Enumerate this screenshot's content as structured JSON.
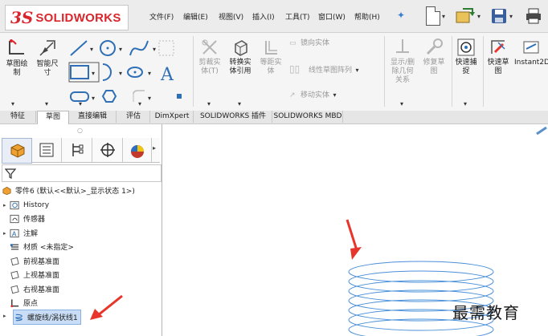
{
  "app": {
    "brand": "SOLIDWORKS",
    "logo_mark": "3S"
  },
  "menu": [
    {
      "label": "文件(F)"
    },
    {
      "label": "编辑(E)"
    },
    {
      "label": "视图(V)"
    },
    {
      "label": "插入(I)"
    },
    {
      "label": "工具(T)"
    },
    {
      "label": "窗口(W)"
    },
    {
      "label": "帮助(H)"
    }
  ],
  "ribbon": {
    "sketch": "草图绘\n制",
    "smart_dim": "智能尺\n寸",
    "cut_entities": "剪裁实\n体(T)",
    "convert_entities": "转换实\n体引用",
    "offset_entities": "等距实\n体",
    "mirror_entities": "镜向实体",
    "linear_pattern": "线性草图阵列",
    "move_entities": "移动实体",
    "display_relations": "显示/删\n除几何\n关系",
    "repair_sketch": "修复草\n图",
    "quick_snaps": "快速捕\n捉",
    "rapid_sketch": "快速草\n图",
    "instant2d": "Instant2D"
  },
  "tabs": [
    {
      "label": "特征"
    },
    {
      "label": "草图",
      "active": true
    },
    {
      "label": "直接编辑"
    },
    {
      "label": "评估"
    },
    {
      "label": "DimXpert"
    },
    {
      "label": "SOLIDWORKS 插件"
    },
    {
      "label": "SOLIDWORKS MBD"
    }
  ],
  "tree": {
    "root": "零件6 (默认<<默认>_显示状态 1>)",
    "items": [
      {
        "label": "History",
        "expandable": true
      },
      {
        "label": "传感器",
        "expandable": false
      },
      {
        "label": "注解",
        "expandable": true
      },
      {
        "label": "材质 <未指定>",
        "expandable": false
      },
      {
        "label": "前视基准面",
        "expandable": false
      },
      {
        "label": "上视基准面",
        "expandable": false
      },
      {
        "label": "右视基准面",
        "expandable": false
      },
      {
        "label": "原点",
        "expandable": false
      },
      {
        "label": "螺旋线/涡状线1",
        "expandable": true,
        "selected": true
      }
    ]
  },
  "watermark": "最需教育",
  "colors": {
    "brand_red": "#d9262c",
    "helix_blue": "#4a90d9",
    "arrow_red": "#e8352b",
    "selection": "#c9def6"
  }
}
